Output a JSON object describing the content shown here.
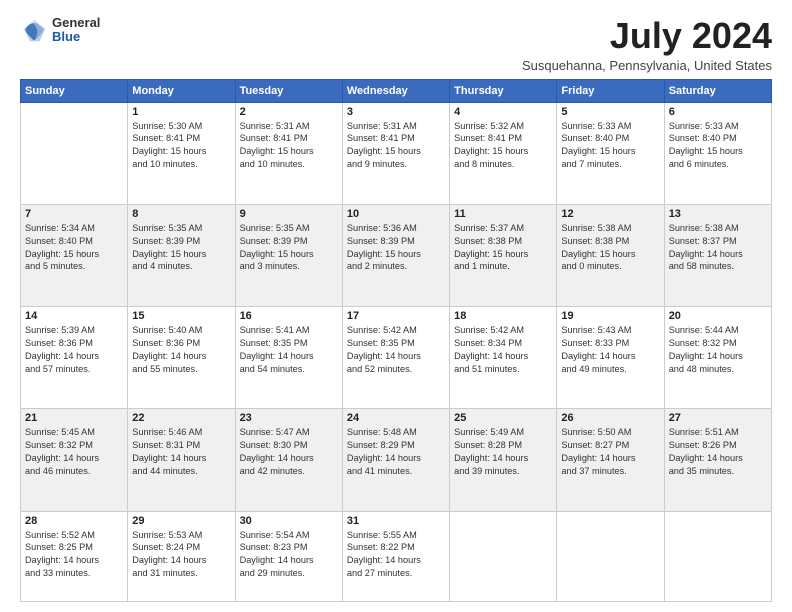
{
  "header": {
    "logo_general": "General",
    "logo_blue": "Blue",
    "month_title": "July 2024",
    "location": "Susquehanna, Pennsylvania, United States"
  },
  "days_of_week": [
    "Sunday",
    "Monday",
    "Tuesday",
    "Wednesday",
    "Thursday",
    "Friday",
    "Saturday"
  ],
  "weeks": [
    [
      {
        "day": "",
        "info": ""
      },
      {
        "day": "1",
        "info": "Sunrise: 5:30 AM\nSunset: 8:41 PM\nDaylight: 15 hours\nand 10 minutes."
      },
      {
        "day": "2",
        "info": "Sunrise: 5:31 AM\nSunset: 8:41 PM\nDaylight: 15 hours\nand 10 minutes."
      },
      {
        "day": "3",
        "info": "Sunrise: 5:31 AM\nSunset: 8:41 PM\nDaylight: 15 hours\nand 9 minutes."
      },
      {
        "day": "4",
        "info": "Sunrise: 5:32 AM\nSunset: 8:41 PM\nDaylight: 15 hours\nand 8 minutes."
      },
      {
        "day": "5",
        "info": "Sunrise: 5:33 AM\nSunset: 8:40 PM\nDaylight: 15 hours\nand 7 minutes."
      },
      {
        "day": "6",
        "info": "Sunrise: 5:33 AM\nSunset: 8:40 PM\nDaylight: 15 hours\nand 6 minutes."
      }
    ],
    [
      {
        "day": "7",
        "info": "Sunrise: 5:34 AM\nSunset: 8:40 PM\nDaylight: 15 hours\nand 5 minutes."
      },
      {
        "day": "8",
        "info": "Sunrise: 5:35 AM\nSunset: 8:39 PM\nDaylight: 15 hours\nand 4 minutes."
      },
      {
        "day": "9",
        "info": "Sunrise: 5:35 AM\nSunset: 8:39 PM\nDaylight: 15 hours\nand 3 minutes."
      },
      {
        "day": "10",
        "info": "Sunrise: 5:36 AM\nSunset: 8:39 PM\nDaylight: 15 hours\nand 2 minutes."
      },
      {
        "day": "11",
        "info": "Sunrise: 5:37 AM\nSunset: 8:38 PM\nDaylight: 15 hours\nand 1 minute."
      },
      {
        "day": "12",
        "info": "Sunrise: 5:38 AM\nSunset: 8:38 PM\nDaylight: 15 hours\nand 0 minutes."
      },
      {
        "day": "13",
        "info": "Sunrise: 5:38 AM\nSunset: 8:37 PM\nDaylight: 14 hours\nand 58 minutes."
      }
    ],
    [
      {
        "day": "14",
        "info": "Sunrise: 5:39 AM\nSunset: 8:36 PM\nDaylight: 14 hours\nand 57 minutes."
      },
      {
        "day": "15",
        "info": "Sunrise: 5:40 AM\nSunset: 8:36 PM\nDaylight: 14 hours\nand 55 minutes."
      },
      {
        "day": "16",
        "info": "Sunrise: 5:41 AM\nSunset: 8:35 PM\nDaylight: 14 hours\nand 54 minutes."
      },
      {
        "day": "17",
        "info": "Sunrise: 5:42 AM\nSunset: 8:35 PM\nDaylight: 14 hours\nand 52 minutes."
      },
      {
        "day": "18",
        "info": "Sunrise: 5:42 AM\nSunset: 8:34 PM\nDaylight: 14 hours\nand 51 minutes."
      },
      {
        "day": "19",
        "info": "Sunrise: 5:43 AM\nSunset: 8:33 PM\nDaylight: 14 hours\nand 49 minutes."
      },
      {
        "day": "20",
        "info": "Sunrise: 5:44 AM\nSunset: 8:32 PM\nDaylight: 14 hours\nand 48 minutes."
      }
    ],
    [
      {
        "day": "21",
        "info": "Sunrise: 5:45 AM\nSunset: 8:32 PM\nDaylight: 14 hours\nand 46 minutes."
      },
      {
        "day": "22",
        "info": "Sunrise: 5:46 AM\nSunset: 8:31 PM\nDaylight: 14 hours\nand 44 minutes."
      },
      {
        "day": "23",
        "info": "Sunrise: 5:47 AM\nSunset: 8:30 PM\nDaylight: 14 hours\nand 42 minutes."
      },
      {
        "day": "24",
        "info": "Sunrise: 5:48 AM\nSunset: 8:29 PM\nDaylight: 14 hours\nand 41 minutes."
      },
      {
        "day": "25",
        "info": "Sunrise: 5:49 AM\nSunset: 8:28 PM\nDaylight: 14 hours\nand 39 minutes."
      },
      {
        "day": "26",
        "info": "Sunrise: 5:50 AM\nSunset: 8:27 PM\nDaylight: 14 hours\nand 37 minutes."
      },
      {
        "day": "27",
        "info": "Sunrise: 5:51 AM\nSunset: 8:26 PM\nDaylight: 14 hours\nand 35 minutes."
      }
    ],
    [
      {
        "day": "28",
        "info": "Sunrise: 5:52 AM\nSunset: 8:25 PM\nDaylight: 14 hours\nand 33 minutes."
      },
      {
        "day": "29",
        "info": "Sunrise: 5:53 AM\nSunset: 8:24 PM\nDaylight: 14 hours\nand 31 minutes."
      },
      {
        "day": "30",
        "info": "Sunrise: 5:54 AM\nSunset: 8:23 PM\nDaylight: 14 hours\nand 29 minutes."
      },
      {
        "day": "31",
        "info": "Sunrise: 5:55 AM\nSunset: 8:22 PM\nDaylight: 14 hours\nand 27 minutes."
      },
      {
        "day": "",
        "info": ""
      },
      {
        "day": "",
        "info": ""
      },
      {
        "day": "",
        "info": ""
      }
    ]
  ]
}
